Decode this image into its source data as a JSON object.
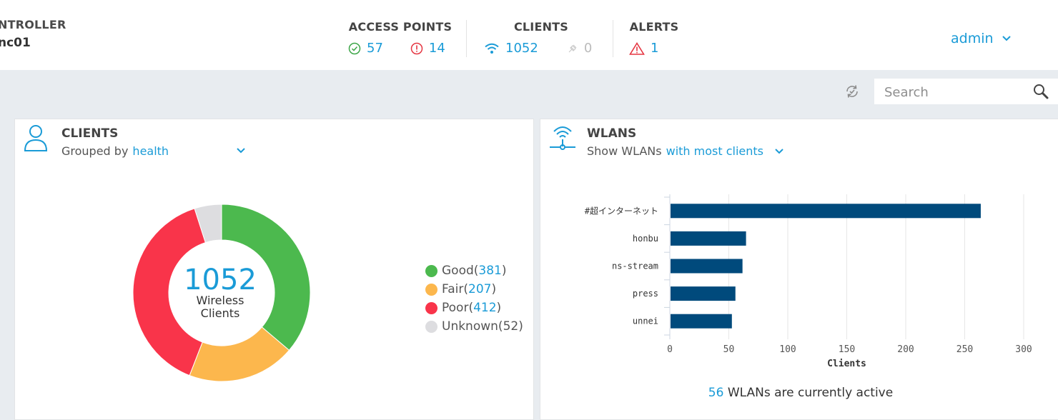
{
  "header": {
    "controller_label": "NTROLLER",
    "controller_name": "nc01",
    "access_points": {
      "title": "ACCESS POINTS",
      "up": "57",
      "down": "14"
    },
    "clients": {
      "title": "CLIENTS",
      "wireless": "1052",
      "wired": "0"
    },
    "alerts": {
      "title": "ALERTS",
      "count": "1"
    },
    "user": "admin"
  },
  "toolbar": {
    "search_placeholder": "Search"
  },
  "clients_panel": {
    "title": "CLIENTS",
    "grouped_by_label": "Grouped by",
    "grouped_by_value": "health",
    "center_value": "1052",
    "center_line1": "Wireless",
    "center_line2": "Clients",
    "legend": [
      {
        "label": "Good",
        "value": "381",
        "color": "#4cb94e"
      },
      {
        "label": "Fair",
        "value": "207",
        "color": "#fcb74d"
      },
      {
        "label": "Poor",
        "value": "412",
        "color": "#f9344a"
      },
      {
        "label": "Unknown",
        "value": "52",
        "color": "#dddde0"
      }
    ]
  },
  "wlans_panel": {
    "title": "WLANS",
    "show_label": "Show WLANs",
    "show_value": "with most clients",
    "footer_count": "56",
    "footer_text": "WLANs are currently active"
  },
  "colors": {
    "accent": "#1a9bd7",
    "bar": "#004a7c"
  },
  "chart_data": [
    {
      "type": "pie",
      "categories": [
        "Good",
        "Fair",
        "Poor",
        "Unknown"
      ],
      "values": [
        381,
        207,
        412,
        52
      ],
      "colors": [
        "#4cb94e",
        "#fcb74d",
        "#f9344a",
        "#dddde0"
      ],
      "donut": true
    },
    {
      "type": "bar",
      "orientation": "horizontal",
      "categories": [
        "#超インターネット",
        "honbu",
        "ns-stream",
        "press",
        "unnei"
      ],
      "values": [
        263,
        64,
        61,
        55,
        52
      ],
      "xlabel": "Clients",
      "xlim": [
        0,
        300
      ],
      "xticks": [
        0,
        50,
        100,
        150,
        200,
        250,
        300
      ],
      "grid": true
    }
  ]
}
